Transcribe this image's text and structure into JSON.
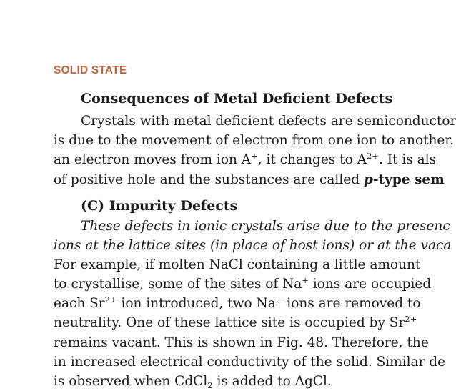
{
  "section_header": "SOLID STATE",
  "sub1": {
    "heading": "Consequences of Metal Deficient Defects",
    "lines": [
      {
        "text": "Crystals with metal deficient defects are semiconductor"
      },
      {
        "text": "is due to the movement of electron from one ion to another."
      },
      {
        "pre": "an electron moves from ion A",
        "sup1": "+",
        "mid": ", it changes to A",
        "sup2": "2+",
        "post": ". It is als"
      },
      {
        "pre": "of positive hole and the substances are called ",
        "p": "p",
        "type_word": "-type ",
        "sem": "sem"
      }
    ]
  },
  "sub2": {
    "heading": "(C) Impurity Defects",
    "italic_lines": [
      "These defects in ionic crystals arise due to the presenc",
      "ions at the lattice sites (in place of host ions) or at the vaca"
    ],
    "lines": [
      {
        "text": "For example, if molten NaCl containing a little amount"
      },
      {
        "pre": "to crystallise, some of the sites of Na",
        "sup": "+",
        "post": " ions are occupied"
      },
      {
        "pre": "each Sr",
        "sup1": "2+",
        "mid": " ion introduced, two Na",
        "sup2": "+",
        "post": " ions are removed to"
      },
      {
        "pre": "neutrality. One of these lattice site is occupied by Sr",
        "sup": "2+"
      },
      {
        "text": "remains vacant. This is shown in Fig. 48. Therefore, the"
      },
      {
        "text": "in increased electrical conductivity of the solid. Similar de"
      },
      {
        "pre": "is observed when CdCl",
        "sub": "2",
        "post": " is added to AgCl."
      }
    ]
  }
}
